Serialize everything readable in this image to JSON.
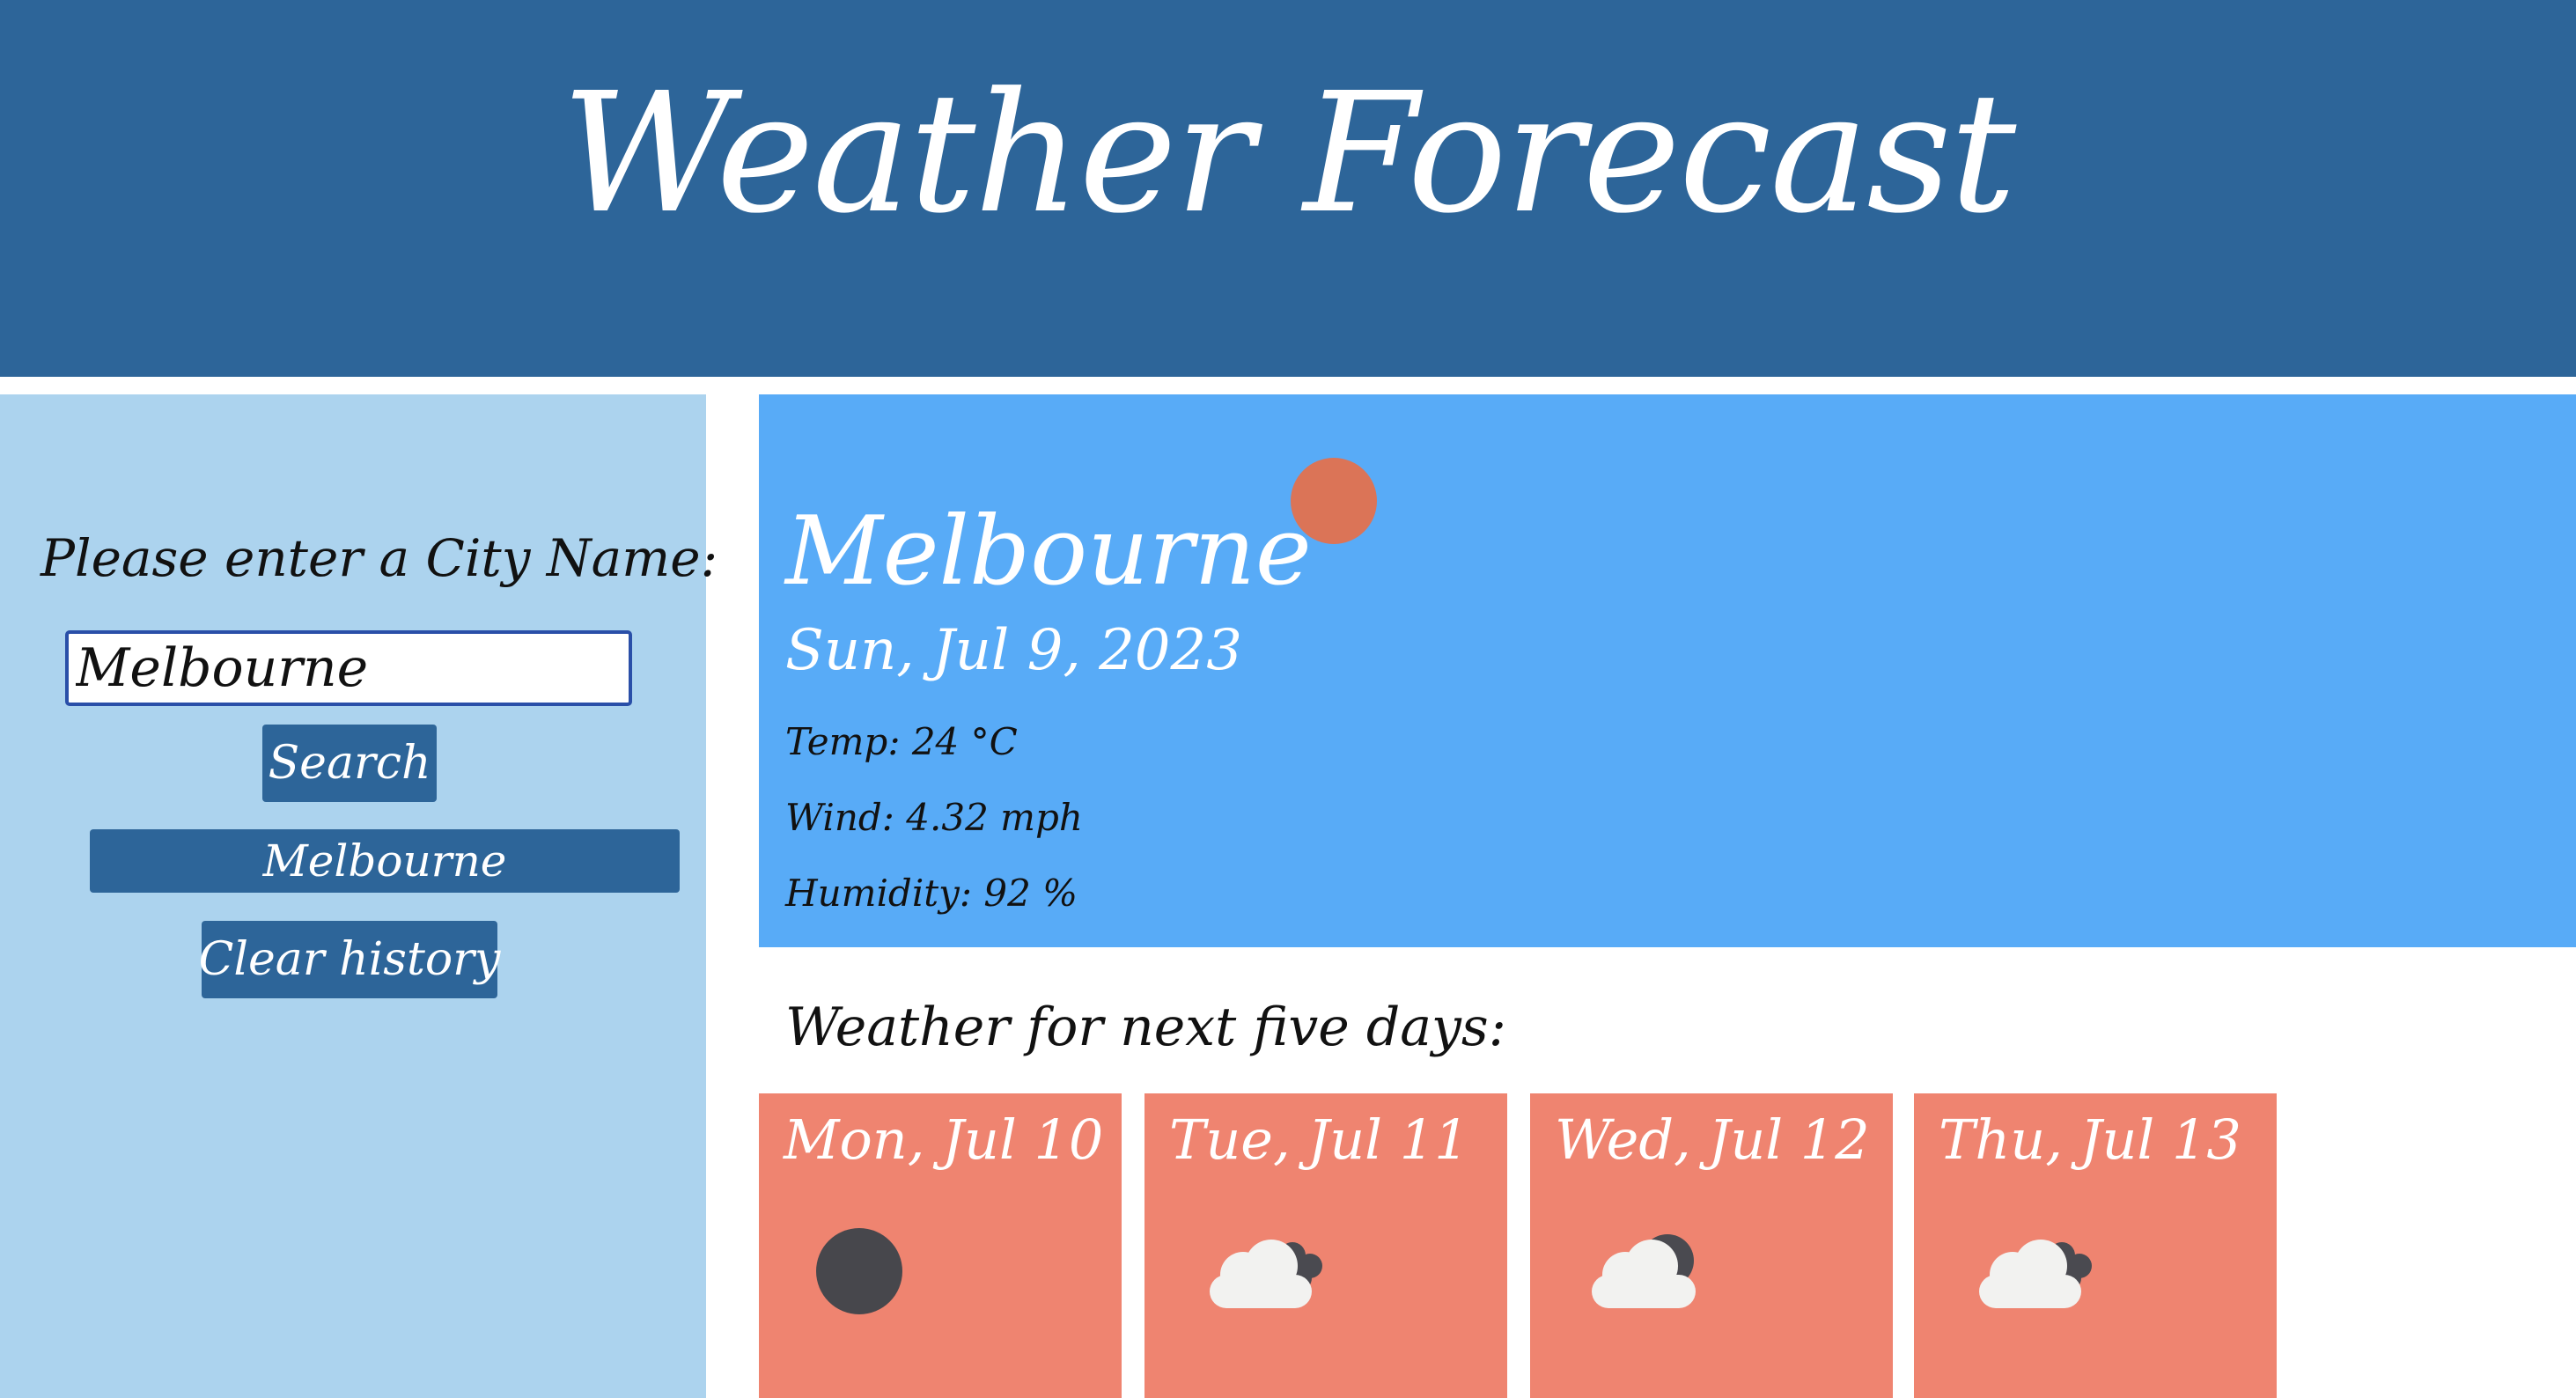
{
  "header": {
    "title": "Weather Forecast"
  },
  "sidebar": {
    "prompt": "Please enter a City Name:",
    "input_value": "Melbourne",
    "search_label": "Search",
    "history": [
      {
        "label": "Melbourne"
      }
    ],
    "clear_label": "Clear history"
  },
  "current": {
    "city": "Melbourne",
    "date": "Sun, Jul 9, 2023",
    "temp": "Temp: 24 °C",
    "wind": "Wind: 4.32 mph",
    "humidity": "Humidity: 92 %",
    "icon": "sun-icon",
    "icon_color": "#db7457"
  },
  "forecast": {
    "heading": "Weather for next five days:",
    "days": [
      {
        "date": "Mon, Jul 10",
        "icon": "moon-icon"
      },
      {
        "date": "Tue, Jul 11",
        "icon": "cloudy-icon"
      },
      {
        "date": "Wed, Jul 12",
        "icon": "cloudy-icon"
      },
      {
        "date": "Thu, Jul 13",
        "icon": "cloudy-icon"
      }
    ]
  },
  "colors": {
    "header": "#2d6599",
    "sidebar": "#acd3ee",
    "current_panel": "#58abf7",
    "forecast_card": "#ef8470",
    "button": "#2d6599"
  }
}
